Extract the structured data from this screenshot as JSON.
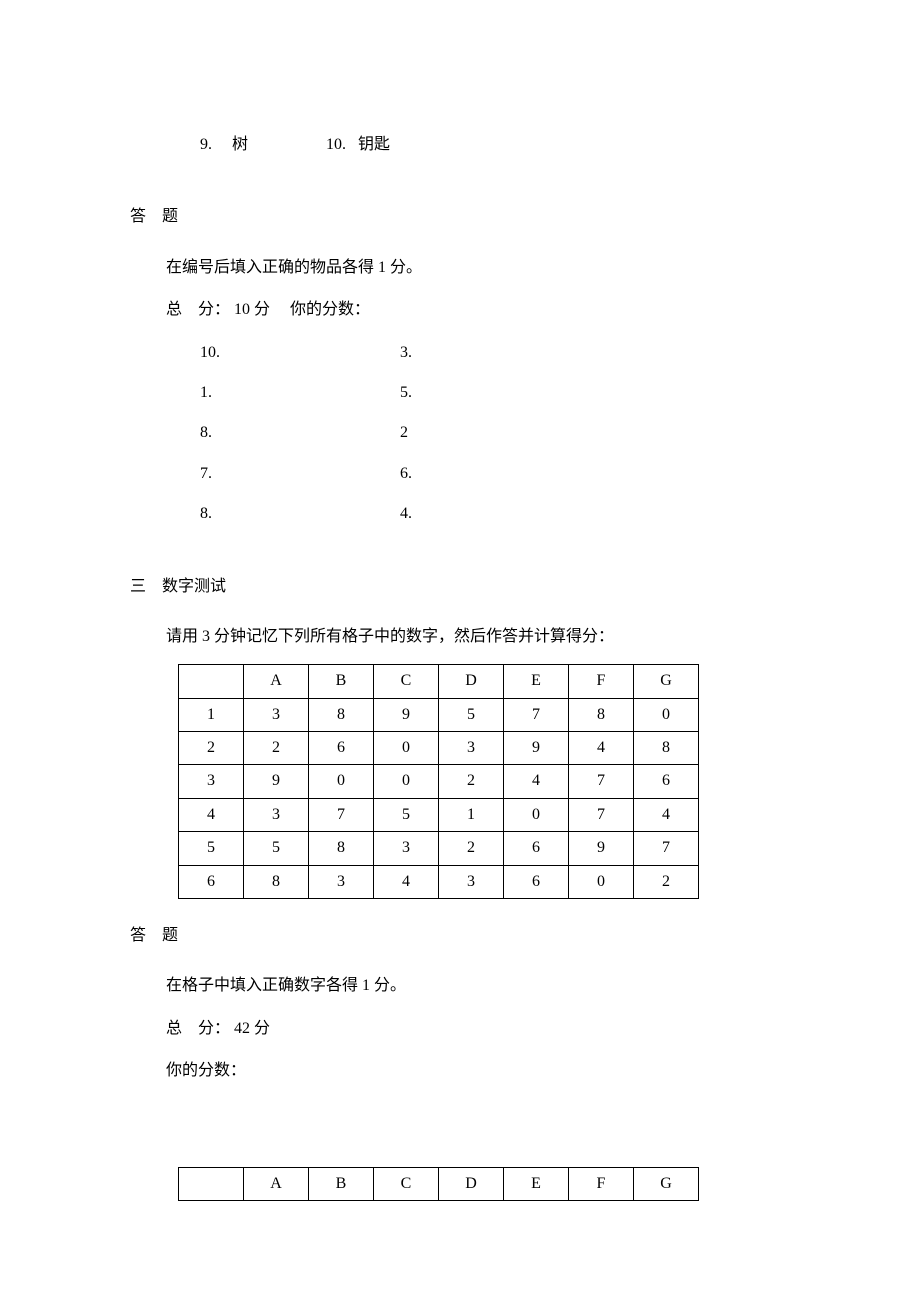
{
  "top_items": {
    "item9_num": "9.",
    "item9_text": "树",
    "item10_num": "10.",
    "item10_text": "钥匙"
  },
  "section_answer_heading": "答　题",
  "answer_instruction": "在编号后填入正确的物品各得 1 分。",
  "total_score_line": "总　分：  10 分　  你的分数：",
  "answer_blanks": {
    "left": [
      "10.",
      "1.",
      "8.",
      "7.",
      "8."
    ],
    "right": [
      "3.",
      "5.",
      "2",
      "6.",
      "4."
    ]
  },
  "section3_heading": "三　数字测试",
  "section3_instruction": "请用 3 分钟记忆下列所有格子中的数字，然后作答并计算得分：",
  "chart_data": {
    "type": "table",
    "title": "数字测试",
    "columns": [
      "A",
      "B",
      "C",
      "D",
      "E",
      "F",
      "G"
    ],
    "row_headers": [
      "1",
      "2",
      "3",
      "4",
      "5",
      "6"
    ],
    "values": [
      [
        3,
        8,
        9,
        5,
        7,
        8,
        0
      ],
      [
        2,
        6,
        0,
        3,
        9,
        4,
        8
      ],
      [
        9,
        0,
        0,
        2,
        4,
        7,
        6
      ],
      [
        3,
        7,
        5,
        1,
        0,
        7,
        4
      ],
      [
        5,
        8,
        3,
        2,
        6,
        9,
        7
      ],
      [
        8,
        3,
        4,
        3,
        6,
        0,
        2
      ]
    ]
  },
  "answer2_heading": "答　题",
  "answer2_instruction": "在格子中填入正确数字各得 1 分。",
  "answer2_total": "总　分：  42 分",
  "answer2_your_score": "你的分数：",
  "answer_table_columns": [
    "A",
    "B",
    "C",
    "D",
    "E",
    "F",
    "G"
  ]
}
